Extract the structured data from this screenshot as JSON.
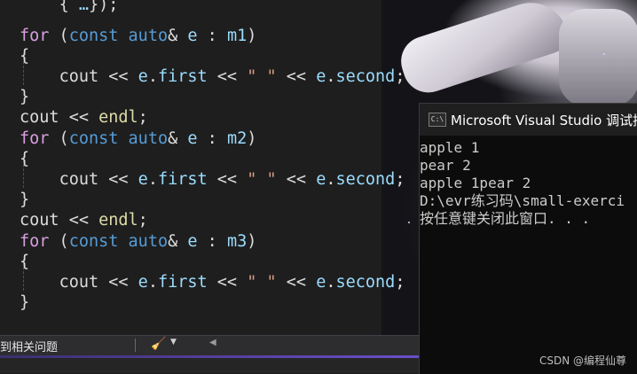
{
  "editor": {
    "lines": [
      {
        "indent": "    ",
        "code": [
          {
            "t": "txt",
            "v": "{ "
          },
          {
            "t": "var",
            "v": "…"
          },
          {
            "t": "txt",
            "v": "});"
          }
        ]
      },
      {
        "indent": "",
        "code": [
          {
            "t": "kw2",
            "v": "for"
          },
          {
            "t": "txt",
            "v": " ("
          },
          {
            "t": "kw",
            "v": "const"
          },
          {
            "t": "txt",
            "v": " "
          },
          {
            "t": "kw",
            "v": "auto"
          },
          {
            "t": "txt",
            "v": "& "
          },
          {
            "t": "var",
            "v": "e"
          },
          {
            "t": "txt",
            "v": " : "
          },
          {
            "t": "var",
            "v": "m1"
          },
          {
            "t": "txt",
            "v": ")"
          }
        ]
      },
      {
        "indent": "",
        "code": [
          {
            "t": "txt",
            "v": "{"
          }
        ]
      },
      {
        "indent": "    ",
        "code": [
          {
            "t": "txt",
            "v": "cout << "
          },
          {
            "t": "var",
            "v": "e"
          },
          {
            "t": "txt",
            "v": "."
          },
          {
            "t": "var",
            "v": "first"
          },
          {
            "t": "txt",
            "v": " << "
          },
          {
            "t": "str",
            "v": "\" \""
          },
          {
            "t": "txt",
            "v": " << "
          },
          {
            "t": "var",
            "v": "e"
          },
          {
            "t": "txt",
            "v": "."
          },
          {
            "t": "var",
            "v": "second"
          },
          {
            "t": "txt",
            "v": ";"
          }
        ]
      },
      {
        "indent": "",
        "code": [
          {
            "t": "txt",
            "v": "}"
          }
        ]
      },
      {
        "indent": "",
        "code": [
          {
            "t": "txt",
            "v": "cout << "
          },
          {
            "t": "fn",
            "v": "endl"
          },
          {
            "t": "txt",
            "v": ";"
          }
        ]
      },
      {
        "indent": "",
        "code": [
          {
            "t": "kw2",
            "v": "for"
          },
          {
            "t": "txt",
            "v": " ("
          },
          {
            "t": "kw",
            "v": "const"
          },
          {
            "t": "txt",
            "v": " "
          },
          {
            "t": "kw",
            "v": "auto"
          },
          {
            "t": "txt",
            "v": "& "
          },
          {
            "t": "var",
            "v": "e"
          },
          {
            "t": "txt",
            "v": " : "
          },
          {
            "t": "var",
            "v": "m2"
          },
          {
            "t": "txt",
            "v": ")"
          }
        ]
      },
      {
        "indent": "",
        "code": [
          {
            "t": "txt",
            "v": "{"
          }
        ]
      },
      {
        "indent": "    ",
        "code": [
          {
            "t": "txt",
            "v": "cout << "
          },
          {
            "t": "var",
            "v": "e"
          },
          {
            "t": "txt",
            "v": "."
          },
          {
            "t": "var",
            "v": "first"
          },
          {
            "t": "txt",
            "v": " << "
          },
          {
            "t": "str",
            "v": "\" \""
          },
          {
            "t": "txt",
            "v": " << "
          },
          {
            "t": "var",
            "v": "e"
          },
          {
            "t": "txt",
            "v": "."
          },
          {
            "t": "var",
            "v": "second"
          },
          {
            "t": "txt",
            "v": ";"
          }
        ]
      },
      {
        "indent": "",
        "code": [
          {
            "t": "txt",
            "v": "}"
          }
        ]
      },
      {
        "indent": "",
        "code": [
          {
            "t": "txt",
            "v": "cout << "
          },
          {
            "t": "fn",
            "v": "endl"
          },
          {
            "t": "txt",
            "v": ";"
          }
        ]
      },
      {
        "indent": "",
        "code": [
          {
            "t": "kw2",
            "v": "for"
          },
          {
            "t": "txt",
            "v": " ("
          },
          {
            "t": "kw",
            "v": "const"
          },
          {
            "t": "txt",
            "v": " "
          },
          {
            "t": "kw",
            "v": "auto"
          },
          {
            "t": "txt",
            "v": "& "
          },
          {
            "t": "var",
            "v": "e"
          },
          {
            "t": "txt",
            "v": " : "
          },
          {
            "t": "var",
            "v": "m3"
          },
          {
            "t": "txt",
            "v": ")"
          }
        ]
      },
      {
        "indent": "",
        "code": [
          {
            "t": "txt",
            "v": "{"
          }
        ]
      },
      {
        "indent": "    ",
        "code": [
          {
            "t": "txt",
            "v": "cout << "
          },
          {
            "t": "var",
            "v": "e"
          },
          {
            "t": "txt",
            "v": "."
          },
          {
            "t": "var",
            "v": "first"
          },
          {
            "t": "txt",
            "v": " << "
          },
          {
            "t": "str",
            "v": "\" \""
          },
          {
            "t": "txt",
            "v": " << "
          },
          {
            "t": "var",
            "v": "e"
          },
          {
            "t": "txt",
            "v": "."
          },
          {
            "t": "var",
            "v": "second"
          },
          {
            "t": "txt",
            "v": ";"
          }
        ]
      },
      {
        "indent": "",
        "code": [
          {
            "t": "txt",
            "v": "}"
          }
        ]
      }
    ]
  },
  "statusbar": {
    "message": "到相关问题",
    "broom_icon": "broom-icon",
    "dropdown_icon": "chevron-down-icon",
    "scroll_icon": "scroll-left-arrow-icon"
  },
  "console": {
    "icon_label": "C:\\",
    "title": "Microsoft Visual Studio 调试控",
    "output": [
      "apple 1",
      "pear 2",
      "apple 1pear 2",
      "D:\\evr练习码\\small-exerci",
      "按任意键关闭此窗口. . ."
    ]
  },
  "watermark": "CSDN @编程仙尊",
  "colors": {
    "editor_bg": "#1e1e1e",
    "keyword": "#569cd6",
    "control_keyword": "#d8a0df",
    "identifier": "#9cdcfe",
    "function": "#dcdcaa",
    "string": "#d69d85",
    "console_bg": "#0c0c0c"
  }
}
